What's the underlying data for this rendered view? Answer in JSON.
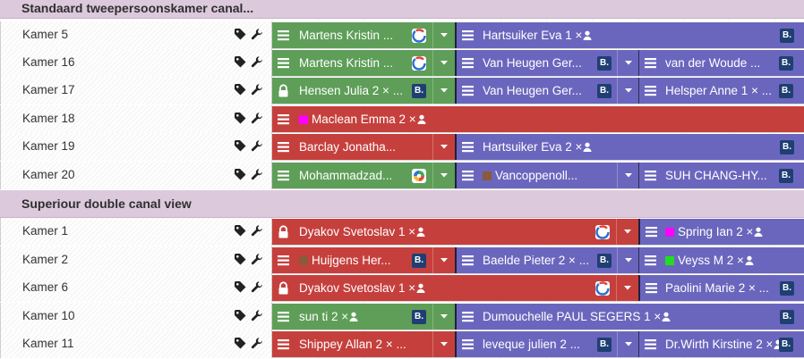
{
  "groups": {
    "standard": "Standaard tweepersoonskamer canal...",
    "superior": "Superiour double canal view"
  },
  "rooms": {
    "r5": "Kamer 5",
    "r16": "Kamer 16",
    "r17": "Kamer 17",
    "r18": "Kamer 18",
    "r19": "Kamer 19",
    "r20": "Kamer 20",
    "r1": "Kamer 1",
    "r2": "Kamer 2",
    "r6": "Kamer 6",
    "r10": "Kamer 10",
    "r11": "Kamer 11"
  },
  "bookings": {
    "b5a": "Martens Kristin ...",
    "b5b": "Hartsuiker Eva  1 ×",
    "b16a": "Martens Kristin ...",
    "b16b": "Van Heugen Ger...",
    "b16c": "van der Woude ...",
    "b17a": "Hensen Julia  2 × ...",
    "b17b": "Van Heugen Ger...",
    "b17c": "Helsper Anne  1 × ...",
    "b18a": "Maclean Emma  2 ×",
    "b19a": "Barclay Jonatha...",
    "b19b": "Hartsuiker Eva  2 ×",
    "b20a": "Mohammadzad...",
    "b20b": "Vancoppenoll...",
    "b20c": "SUH CHANG-HY...",
    "b1a": "Dyakov Svetoslav  1 ×",
    "b1b": "Spring Ian  2 ×",
    "b2a": "Huijgens Her...",
    "b2b": "Baelde Pieter  2 × ...",
    "b2c": "Veyss M  2 ×",
    "b6a": "Dyakov Svetoslav  1 ×",
    "b6b": "Paolini Marie  2 × ...",
    "b10a": "sun ti  2 ×",
    "b10b": "Dumouchelle PAUL SEGERS  1 ×",
    "b11a": "Shippey Allan  2 × ...",
    "b11b": "leveque julien  2 ...",
    "b11c": "Dr.Wirth Kirstine  2 ×"
  },
  "source_badge_letter": "B.",
  "colors": {
    "available": "#5e9e58",
    "occupied": "#c5403d",
    "future": "#6b66bd",
    "group_header": "#dcc9dc",
    "swatch_magenta": "#ff00ff",
    "swatch_brown": "#8b5a3c",
    "swatch_green": "#22dd22"
  },
  "icons": [
    "tag-icon",
    "wrench-icon",
    "menu-icon",
    "lock-icon",
    "person-icon",
    "chevron-down-icon",
    "booking-source-badge",
    "refresh-source-icon"
  ]
}
